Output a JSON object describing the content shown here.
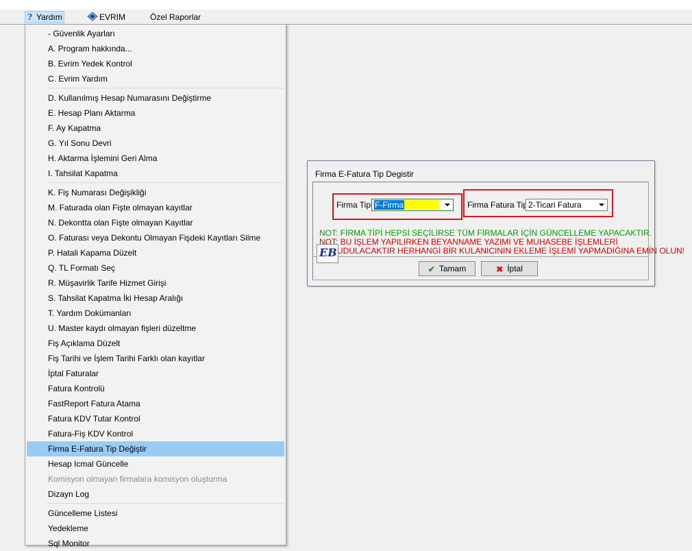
{
  "menubar": {
    "items": [
      {
        "label": "Yardım",
        "icon": "help-icon"
      },
      {
        "label": "EVRIM",
        "icon": "evrim-app-icon"
      },
      {
        "label": "Özel Raporlar"
      }
    ]
  },
  "menu": {
    "groups": [
      [
        "- Güvenlik Ayarları",
        "A.   Program hakkında...",
        "B.   Evrim Yedek Kontrol",
        "C.   Evrim Yardım"
      ],
      [
        "D.   Kullanılmış Hesap Numarasını Değiştirme",
        "E.   Hesap Planı Aktarma",
        "F.   Ay Kapatma",
        "G.   Yıl Sonu Devri",
        "H.   Aktarma İşlemini Geri Alma",
        "I.   Tahsilat Kapatma"
      ],
      [
        "K.  Fiş Numarası Değişikliği",
        "M. Faturada olan Fişte olmayan kayıtlar",
        "N.  Dekontta olan Fişte olmayan Kayıtlar",
        "O. Faturası veya Dekontu Olmayan Fişdeki Kayıtları Silme",
        "P. Hatali Kapama Düzelt",
        "Q. TL Formatı Seç",
        "R. Müşavirlik Tarife Hizmet Girişi",
        "S.   Tahsilat Kapatma İki Hesap Aralığı",
        "T. Yardım Dokümanları",
        "U. Master kaydı olmayan fişleri düzeltme",
        "Fiş Açıklama Düzelt",
        "Fiş Tarihi ve İşlem Tarihi Farklı olan kayıtlar",
        "İptal Faturalar",
        "Fatura Kontrolü",
        "FastReport Fatura Atama",
        "Fatura KDV Tutar Kontrol",
        "Fatura-Fiş KDV Kontrol",
        "Firma E-Fatura Tip Değiştir",
        "Hesap Icmal Güncelle",
        "Komisyon olmayan firmalara komisyon oluşturma",
        "Dizayn Log"
      ],
      [
        "Güncelleme Listesi",
        "Yedekleme",
        "Sql Monitor"
      ]
    ],
    "highlighted": "Firma E-Fatura Tip Değiştir",
    "disabled": "Komisyon olmayan firmalara komisyon oluşturma"
  },
  "dialog": {
    "title": "Firma E-Fatura Tip Degistir",
    "firma_tipi_label": "Firma Tipi",
    "firma_tipi_value": "F-Firma",
    "fatura_tipi_label": "Firma Fatura Tipi",
    "fatura_tipi_value": "2-Ticari Fatura",
    "note1": "NOT: FİRMA TİPİ HEPSİ SEÇİLİRSE TÜM FİRMALAR İÇİN GÜNCELLEME YAPACAKTIR.",
    "note2a": "NOT: BU İŞLEM YAPILIRKEN BEYANNAME YAZIMI VE MUHASEBE İŞLEMLERİ",
    "note2b": "DURUDULACAKTIR  HERHANGİ BİR KULANICININ EKLEME İŞLEMİ YAPMADIĞINA EMİN OLUN!",
    "ok_label": "Tamam",
    "cancel_label": "İptal",
    "logo_text": "EB"
  },
  "colors": {
    "highlight": "#99ccf4",
    "combo_selected_bg": "#ffff00",
    "annotation_red": "#e81123",
    "note_green": "#00a000",
    "note_red": "#e00000"
  }
}
